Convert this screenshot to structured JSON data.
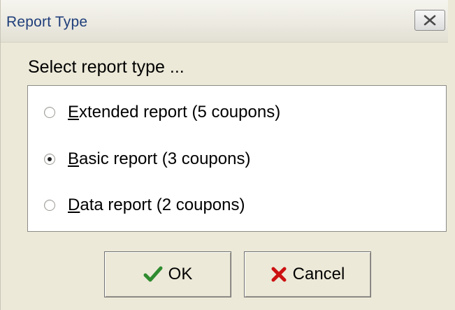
{
  "window": {
    "title": "Report Type",
    "close_icon": "close-x-icon"
  },
  "prompt": "Select report type ...",
  "options": [
    {
      "mnemonic": "E",
      "rest": "xtended report (5 coupons)",
      "checked": false
    },
    {
      "mnemonic": "B",
      "rest": "asic report (3 coupons)",
      "checked": true
    },
    {
      "mnemonic": "D",
      "rest": "ata report (2 coupons)",
      "checked": false
    }
  ],
  "buttons": {
    "ok": {
      "label": "OK",
      "icon": "checkmark-icon",
      "icon_color": "#2e8b2e"
    },
    "cancel": {
      "label": "Cancel",
      "icon": "x-mark-icon",
      "icon_color": "#cc1111"
    }
  }
}
